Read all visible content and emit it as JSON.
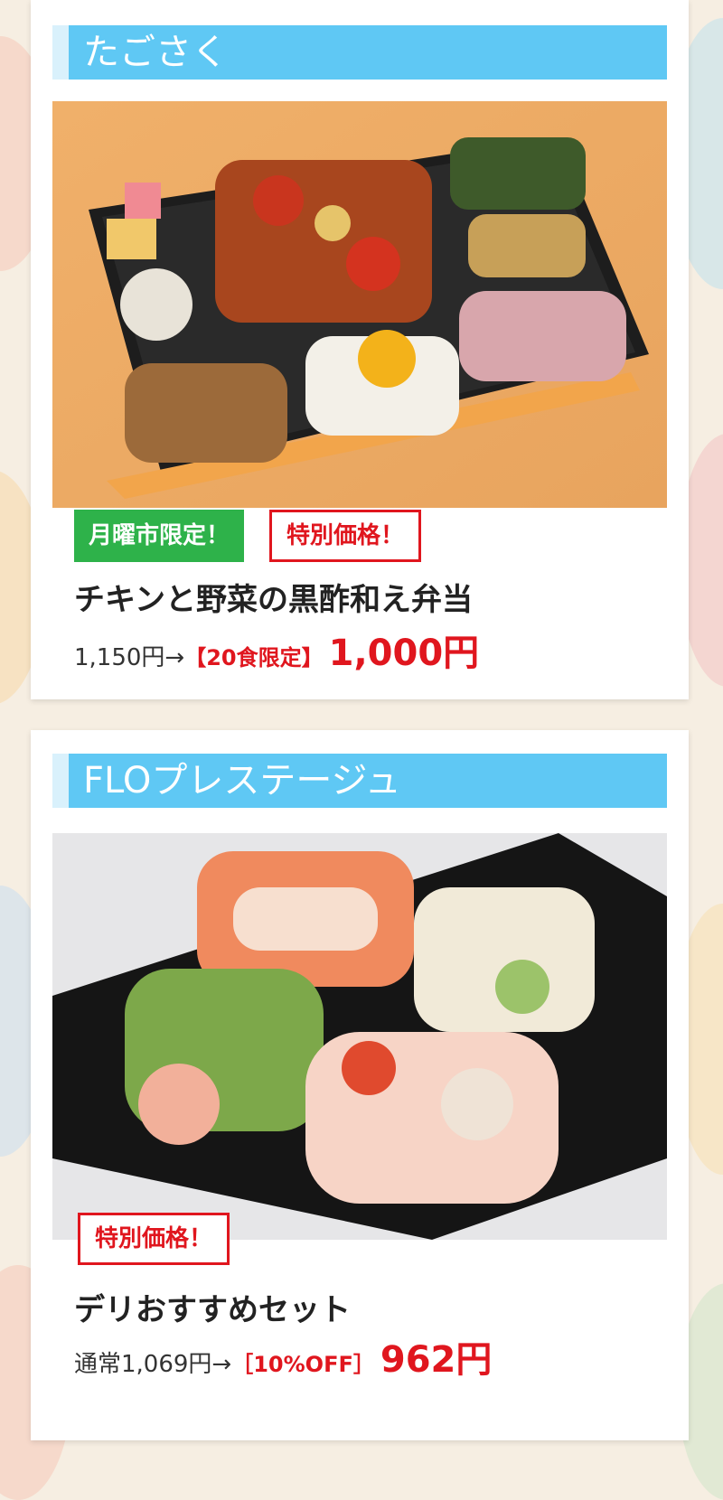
{
  "shops": [
    {
      "name": "たごさく",
      "badges": [
        "月曜市限定！",
        "特別価格！"
      ],
      "product_name": "チキンと野菜の黒酢和え弁当",
      "regular_price": "1,150円→",
      "limit_tag": "【20食限定】",
      "sale_price": "1,000円"
    },
    {
      "name": "FLOプレステージュ",
      "badges": [
        "特別価格！"
      ],
      "product_name": "デリおすすめセット",
      "regular_price": "通常1,069円→",
      "limit_tag": "［10%OFF］",
      "sale_price": "962円"
    }
  ],
  "colors": {
    "header_bg": "#5fc8f4",
    "badge_green": "#2eb24a",
    "accent_red": "#e0161e"
  }
}
